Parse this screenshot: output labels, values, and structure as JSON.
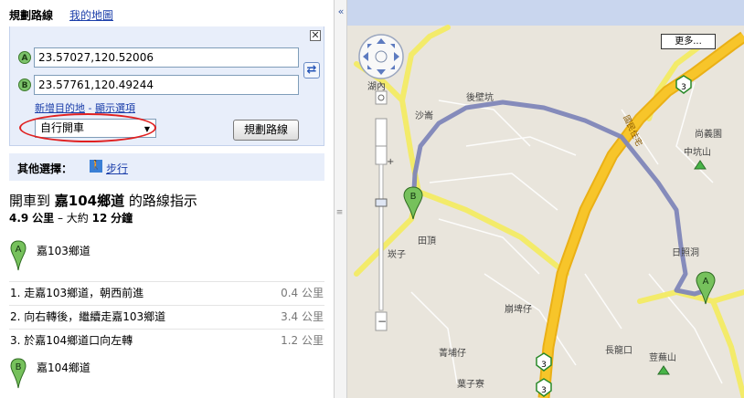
{
  "tabs": {
    "directions": "規劃路線",
    "my_maps": "我的地圖"
  },
  "form": {
    "close_glyph": "✕",
    "origin": {
      "marker": "A",
      "value": "23.57027,120.52006"
    },
    "destination": {
      "marker": "B",
      "value": "23.57761,120.49244"
    },
    "add_destination": "新增目的地",
    "separator": " - ",
    "show_options": "顯示選項",
    "mode_selected": "自行開車",
    "plan_button": "規劃路線",
    "swap_icon": "swap-icon"
  },
  "alternatives": {
    "label": "其他選擇：",
    "walk": "步行"
  },
  "route": {
    "title_prefix": "開車到",
    "title_road": "嘉104鄉道",
    "title_suffix": "的路線指示",
    "distance_value": "4.9",
    "distance_unit": "公里",
    "time_prefix": "– 大約",
    "time_value": "12",
    "time_unit": "分鐘",
    "start_label": "嘉103鄉道",
    "end_label": "嘉104鄉道",
    "steps": [
      {
        "text": "1. 走嘉103鄉道，朝西前進",
        "dist": "0.4 公里"
      },
      {
        "text": "2. 向右轉後，繼續走嘉103鄉道",
        "dist": "3.4 公里"
      },
      {
        "text": "3. 於嘉104鄉道口向左轉",
        "dist": "1.2 公里"
      }
    ]
  },
  "map": {
    "more_button": "更多...",
    "zoom_in": "+",
    "zoom_out": "−",
    "road_shield": "3",
    "labels": [
      "後壁坑",
      "沙崙",
      "尚義園",
      "中坑山",
      "田頂",
      "崁子",
      "日照洞",
      "崩埤仔",
      "菁埔仔",
      "長龍口",
      "荳蕪山",
      "葉子寮",
      "湖內",
      "國民住宅"
    ],
    "marker_a": "A",
    "marker_b": "B",
    "colors": {
      "route": "#8a8fb5",
      "highway": "#f0b000",
      "road": "#f5f07a",
      "land": "#e9e5dc"
    }
  }
}
